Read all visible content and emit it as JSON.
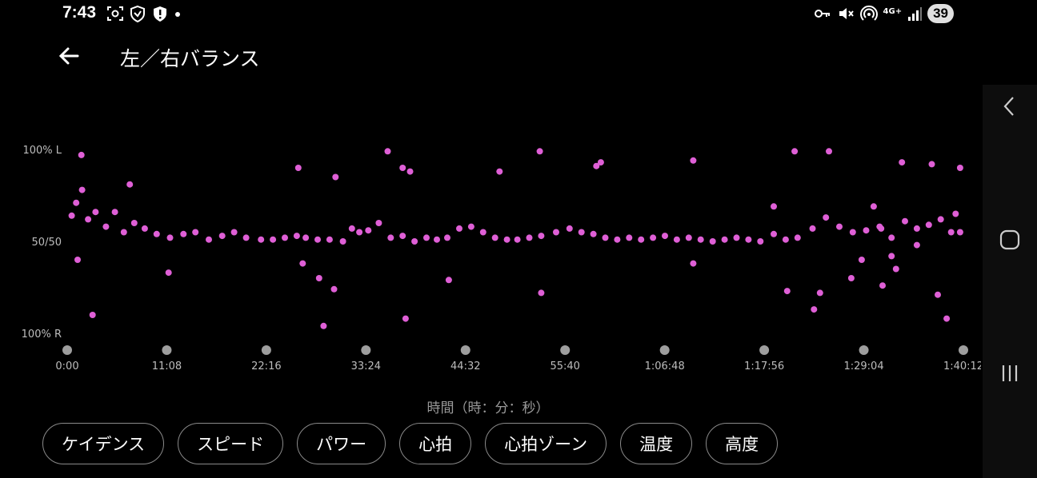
{
  "status_bar": {
    "time": "7:43",
    "battery": "39",
    "network": "4G+",
    "icons_left": [
      "screenshot-icon",
      "shield-icon",
      "alert-shield-icon",
      "dot-icon"
    ],
    "icons_right": [
      "key-icon",
      "mute-icon",
      "hotspot-icon",
      "signal-icon"
    ]
  },
  "header": {
    "title": "左／右バランス",
    "back_icon": "arrow-left-icon"
  },
  "chart_data": {
    "type": "scatter",
    "title": "左／右バランス",
    "xlabel": "時間（時：分：秒）",
    "ylabel": "",
    "x_ticks": [
      "0:00",
      "11:08",
      "22:16",
      "33:24",
      "44:32",
      "55:40",
      "1:06:48",
      "1:17:56",
      "1:29:04",
      "1:40:12"
    ],
    "x_tick_seconds": [
      0,
      668,
      1336,
      2004,
      2672,
      3340,
      4008,
      4676,
      5344,
      6012
    ],
    "xlim_seconds": [
      0,
      6012
    ],
    "y_ticks": [
      {
        "label": "100% L",
        "value": 100
      },
      {
        "label": "50/50",
        "value": 50
      },
      {
        "label": "100% R",
        "value": 0
      }
    ],
    "ylim": [
      0,
      100
    ],
    "y_unit": "% left",
    "series": [
      {
        "color": "#df5fd6",
        "points": [
          [
            30,
            64
          ],
          [
            60,
            71
          ],
          [
            100,
            78
          ],
          [
            140,
            62
          ],
          [
            190,
            66
          ],
          [
            260,
            58
          ],
          [
            320,
            66
          ],
          [
            380,
            55
          ],
          [
            450,
            60
          ],
          [
            520,
            57
          ],
          [
            600,
            54
          ],
          [
            690,
            52
          ],
          [
            780,
            54
          ],
          [
            860,
            55
          ],
          [
            950,
            51
          ],
          [
            1040,
            53
          ],
          [
            1120,
            55
          ],
          [
            1200,
            52
          ],
          [
            1300,
            51
          ],
          [
            1380,
            51
          ],
          [
            1460,
            52
          ],
          [
            1540,
            53
          ],
          [
            1600,
            52
          ],
          [
            1680,
            51
          ],
          [
            1760,
            51
          ],
          [
            1850,
            50
          ],
          [
            1910,
            57
          ],
          [
            1960,
            55
          ],
          [
            2020,
            56
          ],
          [
            2090,
            60
          ],
          [
            2170,
            52
          ],
          [
            2250,
            53
          ],
          [
            2330,
            50
          ],
          [
            2410,
            52
          ],
          [
            2480,
            51
          ],
          [
            2550,
            52
          ],
          [
            2630,
            57
          ],
          [
            2710,
            58
          ],
          [
            2790,
            55
          ],
          [
            2870,
            52
          ],
          [
            2950,
            51
          ],
          [
            3020,
            51
          ],
          [
            3100,
            52
          ],
          [
            3180,
            53
          ],
          [
            3280,
            55
          ],
          [
            3370,
            57
          ],
          [
            3450,
            55
          ],
          [
            3530,
            54
          ],
          [
            3610,
            52
          ],
          [
            3690,
            51
          ],
          [
            3770,
            52
          ],
          [
            3850,
            51
          ],
          [
            3930,
            52
          ],
          [
            4010,
            53
          ],
          [
            4090,
            51
          ],
          [
            4170,
            52
          ],
          [
            4250,
            51
          ],
          [
            4330,
            50
          ],
          [
            4410,
            51
          ],
          [
            4490,
            52
          ],
          [
            4570,
            51
          ],
          [
            4650,
            50
          ],
          [
            4740,
            54
          ],
          [
            4820,
            51
          ],
          [
            4900,
            52
          ],
          [
            5000,
            57
          ],
          [
            5090,
            63
          ],
          [
            5180,
            58
          ],
          [
            5270,
            55
          ],
          [
            5360,
            56
          ],
          [
            5450,
            58
          ],
          [
            5530,
            52
          ],
          [
            5620,
            61
          ],
          [
            5700,
            57
          ],
          [
            5780,
            59
          ],
          [
            5860,
            62
          ],
          [
            5930,
            55
          ],
          [
            5990,
            55
          ],
          [
            5990,
            90
          ],
          [
            70,
            40
          ],
          [
            95,
            97
          ],
          [
            170,
            10
          ],
          [
            420,
            81
          ],
          [
            680,
            33
          ],
          [
            1550,
            90
          ],
          [
            1580,
            38
          ],
          [
            1690,
            30
          ],
          [
            1800,
            85
          ],
          [
            1720,
            4
          ],
          [
            1790,
            24
          ],
          [
            2150,
            99
          ],
          [
            2250,
            90
          ],
          [
            2300,
            88
          ],
          [
            2270,
            8
          ],
          [
            2560,
            29
          ],
          [
            2900,
            88
          ],
          [
            3180,
            22
          ],
          [
            3170,
            99
          ],
          [
            3550,
            91
          ],
          [
            3580,
            93
          ],
          [
            4200,
            94
          ],
          [
            4200,
            38
          ],
          [
            4740,
            69
          ],
          [
            4830,
            23
          ],
          [
            4880,
            99
          ],
          [
            5010,
            13
          ],
          [
            5110,
            99
          ],
          [
            5050,
            22
          ],
          [
            5330,
            40
          ],
          [
            5600,
            93
          ],
          [
            5800,
            92
          ],
          [
            5840,
            21
          ],
          [
            5900,
            8
          ],
          [
            5960,
            65
          ],
          [
            5410,
            69
          ],
          [
            5460,
            57
          ],
          [
            5700,
            48
          ],
          [
            5260,
            30
          ],
          [
            5470,
            26
          ],
          [
            5530,
            42
          ],
          [
            5560,
            35
          ]
        ]
      }
    ]
  },
  "chips": [
    "ケイデンス",
    "スピード",
    "パワー",
    "心拍",
    "心拍ゾーン",
    "温度",
    "高度"
  ],
  "nav": [
    "chevron-left-icon",
    "home-square-icon",
    "recents-icon"
  ]
}
